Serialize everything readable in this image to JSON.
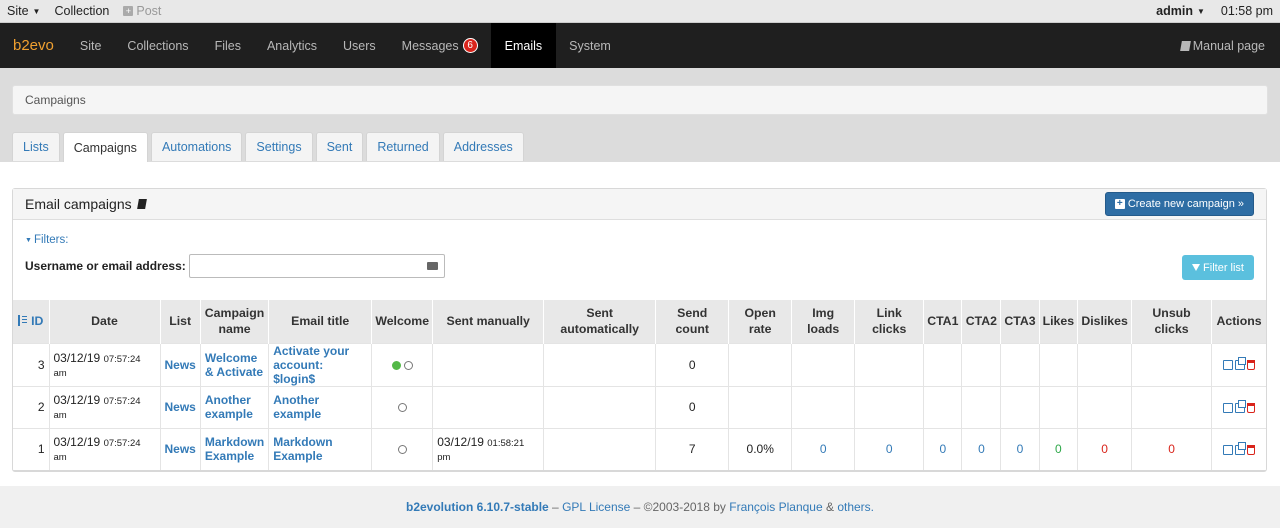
{
  "topbar": {
    "site": "Site",
    "collection": "Collection",
    "post": "Post",
    "user": "admin",
    "time": "01:58 pm"
  },
  "nav": {
    "brand": "b2evo",
    "items": [
      "Site",
      "Collections",
      "Files",
      "Analytics",
      "Users",
      "Messages",
      "Emails",
      "System"
    ],
    "messages_badge": "6",
    "active": "Emails",
    "manual": "Manual page"
  },
  "breadcrumb": "Campaigns",
  "tabs": [
    "Lists",
    "Campaigns",
    "Automations",
    "Settings",
    "Sent",
    "Returned",
    "Addresses"
  ],
  "active_tab": "Campaigns",
  "panel": {
    "title": "Email campaigns",
    "create_button": "Create new campaign »",
    "filters_toggle": "Filters:",
    "filter_label": "Username or email address:",
    "filter_value": "",
    "filter_button": "Filter list"
  },
  "table": {
    "headers": {
      "id": "ID",
      "date": "Date",
      "list": "List",
      "campaign_name": "Campaign name",
      "email_title": "Email title",
      "welcome": "Welcome",
      "sent_manually": "Sent manually",
      "sent_automatically": "Sent automatically",
      "send_count": "Send count",
      "open_rate": "Open rate",
      "img_loads": "Img loads",
      "link_clicks": "Link clicks",
      "cta1": "CTA1",
      "cta2": "CTA2",
      "cta3": "CTA3",
      "likes": "Likes",
      "dislikes": "Dislikes",
      "unsub_clicks": "Unsub clicks",
      "actions": "Actions"
    },
    "rows": [
      {
        "id": "3",
        "date": "03/12/19",
        "time": "07:57:24 am",
        "list": "News",
        "name": "Welcome & Activate",
        "title": "Activate your account: $login$",
        "welcome": "active",
        "sent_manually_date": "",
        "sent_manually_time": "",
        "sent_auto": "",
        "send_count": "0",
        "open_rate": "",
        "img_loads": "",
        "link_clicks": "",
        "cta1": "",
        "cta2": "",
        "cta3": "",
        "likes": "",
        "dislikes": "",
        "unsub": ""
      },
      {
        "id": "2",
        "date": "03/12/19",
        "time": "07:57:24 am",
        "list": "News",
        "name": "Another example",
        "title": "Another example",
        "welcome": "inactive",
        "sent_manually_date": "",
        "sent_manually_time": "",
        "sent_auto": "",
        "send_count": "0",
        "open_rate": "",
        "img_loads": "",
        "link_clicks": "",
        "cta1": "",
        "cta2": "",
        "cta3": "",
        "likes": "",
        "dislikes": "",
        "unsub": ""
      },
      {
        "id": "1",
        "date": "03/12/19",
        "time": "07:57:24 am",
        "list": "News",
        "name": "Markdown Example",
        "title": "Markdown Example",
        "welcome": "inactive",
        "sent_manually_date": "03/12/19",
        "sent_manually_time": "01:58:21 pm",
        "sent_auto": "",
        "send_count": "7",
        "open_rate": "0.0%",
        "img_loads": "0",
        "link_clicks": "0",
        "cta1": "0",
        "cta2": "0",
        "cta3": "0",
        "likes": "0",
        "dislikes": "0",
        "unsub": "0"
      }
    ]
  },
  "footer": {
    "product": "b2evolution 6.10.7-stable",
    "sep1": " – ",
    "license": "GPL License",
    "copyright": " – ©2003-2018 by ",
    "author": "François Planque",
    "and": " & ",
    "others": "others."
  },
  "colors": {
    "nav_bg": "#1f1f1f",
    "brand": "#f0a030",
    "link": "#337ab7",
    "primary_btn": "#2e6da4",
    "info_btn": "#5bc0de",
    "badge": "#d9241b",
    "likes": "#2ea84a",
    "dislikes": "#d9241b"
  }
}
